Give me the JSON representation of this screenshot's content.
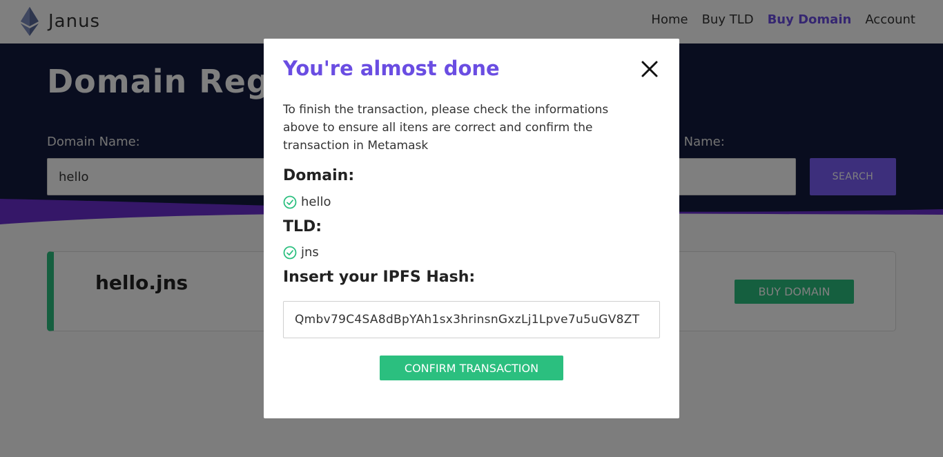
{
  "navbar": {
    "brand": "Janus",
    "links": [
      {
        "label": "Home"
      },
      {
        "label": "Buy TLD"
      },
      {
        "label": "Buy Domain"
      },
      {
        "label": "Account"
      }
    ]
  },
  "hero": {
    "title": "Domain Registration",
    "domain_label": "Domain Name:",
    "domain_value": "hello",
    "tld_label": "TLD Name:",
    "search_label": "SEARCH"
  },
  "result": {
    "name": "hello.jns",
    "buy_label": "BUY DOMAIN"
  },
  "modal": {
    "title": "You're almost done",
    "description": "To finish the transaction, please check the informations above to ensure all itens are correct and confirm the transaction in Metamask",
    "domain_heading": "Domain:",
    "domain_value": "hello",
    "tld_heading": "TLD:",
    "tld_value": "jns",
    "ipfs_heading": "Insert your IPFS Hash:",
    "ipfs_value": "Qmbv79C4SA8dBpYAh1sx3hrinsnGxzLj1Lpve7u5uGV8ZT",
    "confirm_label": "CONFIRM TRANSACTION"
  },
  "icons": {
    "brand": "ethereum-logo-icon",
    "close": "close-icon",
    "check": "check-circle-icon"
  },
  "colors": {
    "accent": "#6a4de2",
    "success": "#2bbf7f",
    "hero_bg": "#131a3e",
    "search_button": "#7a5ef8"
  }
}
